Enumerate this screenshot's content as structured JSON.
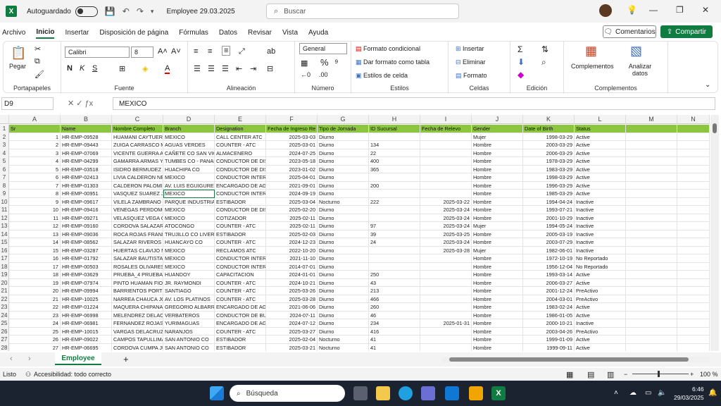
{
  "titlebar": {
    "autosave_label": "Autoguardado",
    "doc_title": "Employee 29.03.2025",
    "search_placeholder": "Buscar"
  },
  "menu": {
    "items": [
      "Archivo",
      "Inicio",
      "Insertar",
      "Disposición de página",
      "Fórmulas",
      "Datos",
      "Revisar",
      "Vista",
      "Ayuda"
    ],
    "active": "Inicio",
    "comments_label": "Comentarios",
    "share_label": "Compartir"
  },
  "ribbon": {
    "paste_label": "Pegar",
    "clipboard_label": "Portapapeles",
    "font_name": "Calibri",
    "font_size": "8",
    "font_label": "Fuente",
    "alignment_label": "Alineación",
    "number_format": "General",
    "number_label": "Número",
    "cond_format": "Formato condicional",
    "table_format": "Dar formato como tabla",
    "cell_styles": "Estilos de celda",
    "styles_label": "Estilos",
    "insert_label": "Insertar",
    "delete_label": "Eliminar",
    "format_label": "Formato",
    "cells_label": "Celdas",
    "editing_label": "Edición",
    "complements_btn": "Complementos",
    "analyze_btn": "Analizar datos",
    "complements_label": "Complementos"
  },
  "formula": {
    "namebox": "D9",
    "value": "MEXICO"
  },
  "columns": [
    "A",
    "B",
    "C",
    "D",
    "E",
    "F",
    "G",
    "H",
    "I",
    "J",
    "K",
    "L",
    "M",
    "N"
  ],
  "header_row": [
    "Sr",
    "Name",
    "Nombre Completo",
    "Branch",
    "Designation",
    "Fecha de Ingreso Re",
    "Tipo de Jornada",
    "ID Sucursal",
    "Fecha de Relevo",
    "Gender",
    "Date of Birth",
    "Status"
  ],
  "rows": [
    [
      "1",
      "HR-EMP-09528",
      "HUAMANI CAYTUERO",
      "MEXICO",
      "CALL CENTER ATC",
      "2025-03-03",
      "Diurno",
      "",
      "",
      "Mujer",
      "1998-03-29",
      "Active"
    ],
    [
      "2",
      "HR-EMP-09443",
      "ZUIGA CARRASCO MA",
      "AGUAS VERDES",
      "COUNTER - ATC",
      "2025-03-01",
      "Diurno",
      "134",
      "",
      "Hombre",
      "2003-03-29",
      "Active"
    ],
    [
      "3",
      "HR-EMP-07069",
      "VICENTE GUERRA AN",
      "CAÑETE CO SAN VICE",
      "ALMACENERO",
      "2024-07-25",
      "Diurno",
      "22",
      "",
      "Hombre",
      "2006-03-29",
      "Active"
    ],
    [
      "4",
      "HR-EMP-04299",
      "GAMARRA ARMAS YV",
      "TUMBES CO - PANAM",
      "CONDUCTOR DE DIST",
      "2023-05-18",
      "Diurno",
      "400",
      "",
      "Hombre",
      "1978-03-29",
      "Active"
    ],
    [
      "5",
      "HR-EMP-03518",
      "ISIDRO BERMUDEZ AL",
      "HUACHIPA CO",
      "CONDUCTOR DE DIST",
      "2023-01-02",
      "Diurno",
      "365",
      "",
      "Hombre",
      "1983-03-29",
      "Active"
    ],
    [
      "6",
      "HR-EMP-02413",
      "LIVIA CALDERON NEX",
      "MEXICO",
      "CONDUCTOR INTERPI",
      "2025-04-01",
      "Diurno",
      "",
      "",
      "Hombre",
      "1998-03-29",
      "Active"
    ],
    [
      "7",
      "HR-EMP-01303",
      "CALDERON PALOMIN",
      "AV. LUIS EGUIGUREN",
      "ENCARGADO DE AGEN",
      "2021-09-01",
      "Diurno",
      "200",
      "",
      "Hombre",
      "1996-03-29",
      "Active"
    ],
    [
      "8",
      "HR-EMP-00951",
      "VASQUEZ SUAREZ JOS",
      "MEXICO",
      "CONDUCTOR INTERPI",
      "2024-09-19",
      "Diurno",
      "",
      "",
      "Hombre",
      "1985-03-29",
      "Active"
    ],
    [
      "9",
      "HR-EMP-09617",
      "VILELA ZAMBRANO JO",
      "PARQUE INDUSTRIAL",
      "ESTIBADOR",
      "2025-03-04",
      "Nocturno",
      "222",
      "2025-03-22",
      "Hombre",
      "1994-04-24",
      "Inactive"
    ],
    [
      "10",
      "HR-EMP-09416",
      "VENEGAS PERDOMO I",
      "MEXICO",
      "CONDUCTOR DE DIST",
      "2025-02-20",
      "Diurno",
      "",
      "2025-03-24",
      "Hombre",
      "1993-07-21",
      "Inactive"
    ],
    [
      "11",
      "HR-EMP-09271",
      "VELASQUEZ VEGA GIA",
      "MEXICO",
      "COTIZADOR",
      "2025-02-11",
      "Diurno",
      "",
      "2025-03-24",
      "Hombre",
      "2001-10-29",
      "Inactive"
    ],
    [
      "12",
      "HR-EMP-09160",
      "CORDOVA SALAZAR F",
      "ATOCONGO",
      "COUNTER - ATC",
      "2025-02-11",
      "Diurno",
      "97",
      "2025-03-24",
      "Mujer",
      "1994-05-24",
      "Inactive"
    ],
    [
      "13",
      "HR-EMP-09036",
      "ROCA ROJAS FRANK A",
      "TRUJILLO CO LIVERPC",
      "ESTIBADOR",
      "2025-02-03",
      "Diurno",
      "39",
      "2025-03-25",
      "Hombre",
      "2005-03-19",
      "Inactive"
    ],
    [
      "14",
      "HR-EMP-08562",
      "SALAZAR RIVEROS JOS",
      "HUANCAYO CO",
      "COUNTER - ATC",
      "2024-12-23",
      "Diurno",
      "24",
      "2025-03-24",
      "Hombre",
      "2003-07-29",
      "Inactive"
    ],
    [
      "15",
      "HR-EMP-03287",
      "HUERTAS CLAVIJO MA",
      "MEXICO",
      "RECLAMOS ATC",
      "2022-10-20",
      "Diurno",
      "",
      "2025-03-28",
      "Mujer",
      "1982-06-01",
      "Inactive"
    ],
    [
      "16",
      "HR-EMP-01792",
      "SALAZAR BAUTISTA EI",
      "MEXICO",
      "CONDUCTOR INTERPI",
      "2021-11-10",
      "Diurno",
      "",
      "",
      "Hombre",
      "1972-10-19",
      "No Reportado"
    ],
    [
      "17",
      "HR-EMP-00503",
      "ROSALES OLIVARES CI",
      "MEXICO",
      "CONDUCTOR INTERPI",
      "2014-07-01",
      "Diurno",
      "",
      "",
      "Hombre",
      "1956-12-04",
      "No Reportado"
    ],
    [
      "18",
      "HR-EMP-03629",
      "PRUEBA_4 PRUEBA_4",
      "HUANDOY",
      "CAPACITACION",
      "2024-01-01",
      "Diurno",
      "250",
      "",
      "Hombre",
      "1993-03-14",
      "Active"
    ],
    [
      "19",
      "HR-EMP-07974",
      "PINTO HUAMAN FIOR",
      "JR. RAYMONDI",
      "COUNTER - ATC",
      "2024-10-21",
      "Diurno",
      "43",
      "",
      "Hombre",
      "2006-03-27",
      "Active"
    ],
    [
      "20",
      "HR-EMP-09994",
      "BARRIENTOS PORTILL",
      "SANTIAGO",
      "COUNTER - ATC",
      "2025-03-26",
      "Diurno",
      "213",
      "",
      "Hombre",
      "2001-12-24",
      "PreActivo"
    ],
    [
      "21",
      "HR-EMP-10025",
      "NARREA CHAUCA JOS",
      "AV. LOS PLATINOS",
      "COUNTER - ATC",
      "2025-03-28",
      "Diurno",
      "466",
      "",
      "Hombre",
      "2004-03-01",
      "PreActivo"
    ],
    [
      "22",
      "HR-EMP-01224",
      "MAQUERA CHIPANA (",
      "GREGORIO ALBARRAC",
      "ENCARGADO DE AGEN",
      "2021-06-06",
      "Diurno",
      "260",
      "",
      "Hombre",
      "1983-02-24",
      "Active"
    ],
    [
      "23",
      "HR-EMP-06998",
      "MELENDREZ DELAO E",
      "VERBATEROS",
      "CONDUCTOR DE BUS",
      "2024-07-11",
      "Diurno",
      "46",
      "",
      "Hombre",
      "1986-01-05",
      "Active"
    ],
    [
      "24",
      "HR-EMP-06981",
      "FERNANDEZ ROJAS H",
      "YURIMAGUAS",
      "ENCARGADO DE AGEN",
      "2024-07-12",
      "Diurno",
      "234",
      "2025-01-31",
      "Hombre",
      "2000-10-21",
      "Inactive"
    ],
    [
      "25",
      "HR-EMP-10015",
      "VARGAS DELACRUZ JO",
      "NARANJOS",
      "COUNTER - ATC",
      "2025-03-27",
      "Diurno",
      "416",
      "",
      "Hombre",
      "2003-04-26",
      "PreActivo"
    ],
    [
      "26",
      "HR-EMP-09022",
      "CAMPOS TAPULLIMA",
      "SAN ANTONIO CO",
      "ESTIBADOR",
      "2025-02-04",
      "Nocturno",
      "41",
      "",
      "Hombre",
      "1999-01-09",
      "Active"
    ],
    [
      "27",
      "HR-EMP-06695",
      "CORDOVA CUMPA JU",
      "SAN ANTONIO CO",
      "ESTIBADOR",
      "2025-03-21",
      "Nocturno",
      "41",
      "",
      "Hombre",
      "1999-09-11",
      "Active"
    ]
  ],
  "sheet": {
    "tab_label": "Employee",
    "add_label": "+"
  },
  "status": {
    "ready": "Listo",
    "accessibility": "Accesibilidad: todo correcto",
    "zoom": "100 %"
  },
  "taskbar": {
    "search_label": "Búsqueda",
    "time": "6:46",
    "date": "29/03/2025"
  }
}
